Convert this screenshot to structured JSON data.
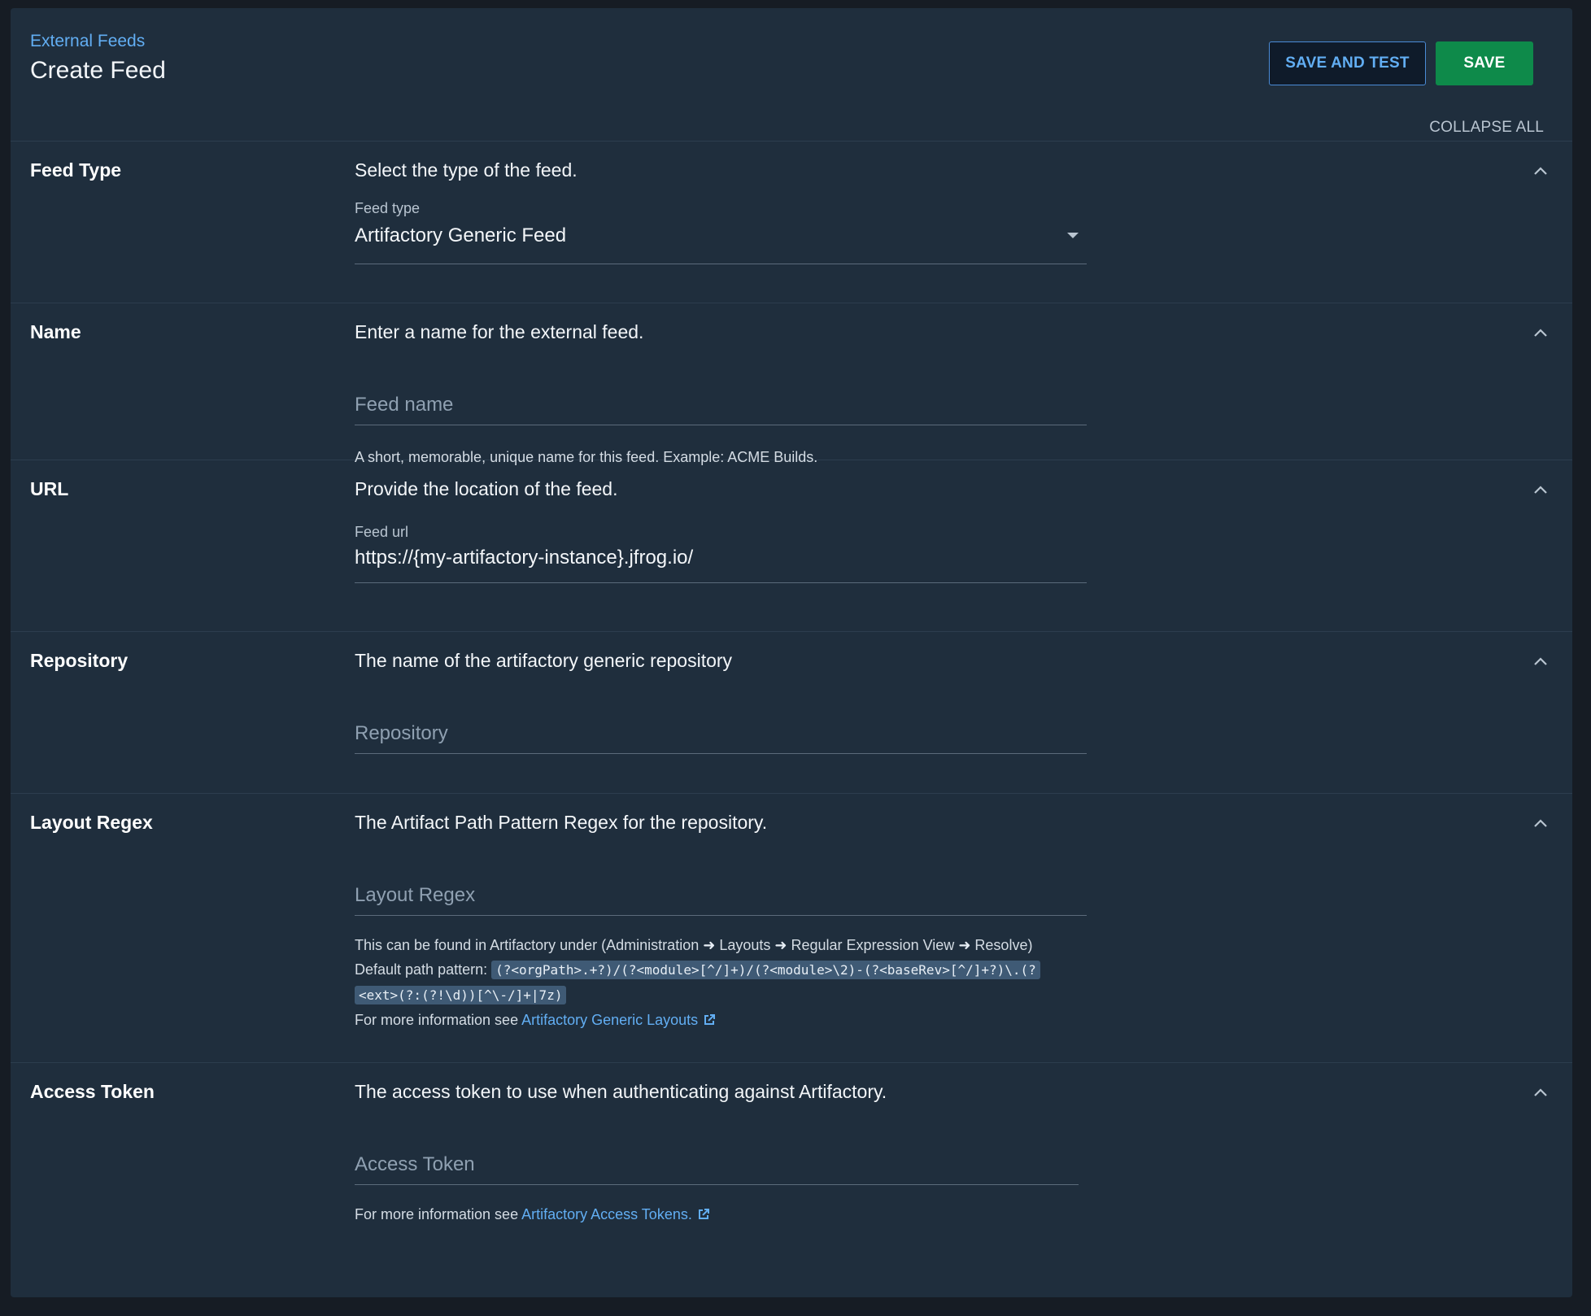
{
  "header": {
    "breadcrumb": "External Feeds",
    "title": "Create Feed",
    "save_and_test_label": "SAVE AND TEST",
    "save_label": "SAVE",
    "collapse_all_label": "COLLAPSE ALL"
  },
  "sections": {
    "feed_type": {
      "title": "Feed Type",
      "description": "Select the type of the feed.",
      "field_label": "Feed type",
      "field_value": "Artifactory Generic Feed"
    },
    "name": {
      "title": "Name",
      "description": "Enter a name for the external feed.",
      "placeholder": "Feed name",
      "help": "A short, memorable, unique name for this feed. Example: ACME Builds."
    },
    "url": {
      "title": "URL",
      "description": "Provide the location of the feed.",
      "field_label": "Feed url",
      "field_value": "https://{my-artifactory-instance}.jfrog.io/"
    },
    "repository": {
      "title": "Repository",
      "description": "The name of the artifactory generic repository",
      "placeholder": "Repository"
    },
    "layout_regex": {
      "title": "Layout Regex",
      "description": "The Artifact Path Pattern Regex for the repository.",
      "placeholder": "Layout Regex",
      "help_line1_prefix": "This can be found in Artifactory under (Administration",
      "help_arrow": "➜",
      "help_line1_part2": "Layouts",
      "help_line1_part3": "Regular Expression View",
      "help_line1_part4": "Resolve)",
      "help_line2_prefix": "Default path pattern:",
      "default_pattern_line1": "(?<orgPath>.+?)/(?<module>[^/]+)/(?<module>\\2)-(?<baseRev>[^/]+?)\\.(?",
      "default_pattern_line2": "<ext>(?:(?!\\d))[^\\-/]+|7z)",
      "help_line3_prefix": "For more information see",
      "help_link": "Artifactory Generic Layouts"
    },
    "access_token": {
      "title": "Access Token",
      "description": "The access token to use when authenticating against Artifactory.",
      "placeholder": "Access Token",
      "help_prefix": "For more information see",
      "help_link": "Artifactory Access Tokens."
    }
  },
  "icons": {
    "collapse": "chevron-up-icon",
    "dropdown": "caret-down-icon",
    "external": "external-link-icon"
  },
  "colors": {
    "background": "#1f2e3d",
    "accent": "#62aef3",
    "primary_button": "#0e8a4a"
  }
}
